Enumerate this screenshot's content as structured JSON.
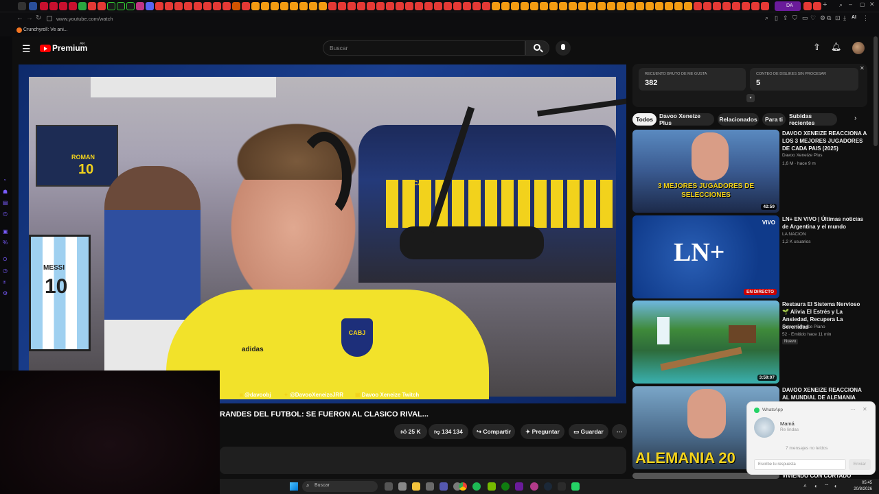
{
  "browser": {
    "url": "www.youtube.com/watch",
    "bookmark_label": "Crunchyroll: Ve ani...",
    "profile_badge": "DA",
    "ai_label": "AI"
  },
  "youtube": {
    "logo_text": "Premium",
    "region": "AR",
    "search_placeholder": "Buscar",
    "likes_panel": {
      "likes_label": "RECUENTO BRUTO DE ME GUSTA",
      "likes_value": "382",
      "dislikes_label": "CONTEO DE DISLIKES SIN PROCESAR",
      "dislikes_value": "5"
    },
    "chips": [
      "Todos",
      "Davoo Xeneize Plus",
      "Relacionados",
      "Para ti",
      "Subidas recientes"
    ],
    "video": {
      "socials": [
        "@davoobj",
        "@DavooXeneizeJRR",
        "Davoo Xeneize Twitch"
      ],
      "title": "RANDES DEL FUTBOL: SE FUERON AL CLASICO RIVAL...",
      "like_count": "25 K",
      "dislike_count": "134  134",
      "share_label": "Compartir",
      "ask_label": "Preguntar",
      "save_label": "Guardar",
      "overlay_text": [
        "ROMAN",
        "10",
        "MESSI",
        "10",
        "CABJ",
        "adidas"
      ]
    },
    "recommendations": [
      {
        "title": "DAVOO XENEIZE REACCIONA A LOS 3 MEJORES JUGADORES DE CADA PAIS (2025)",
        "channel": "Davoo Xeneize Plus",
        "meta": "1,6 M · hace 9 m",
        "duration": "42:59",
        "thumb_text": "3 MEJORES JUGADORES DE SELECCIONES"
      },
      {
        "title": "LN+ EN VIVO | Últimas noticias de Argentina y el mundo",
        "channel": "LA NACION",
        "meta": "1,2 K usuarios",
        "duration": "EN DIRECTO",
        "thumb_text": "LN+",
        "live_label": "VIVO"
      },
      {
        "title": "Restaura El Sistema Nervioso 🌱 Alivia El Estrés y La Ansiedad, Recupera La Serenidad",
        "channel": "Nature's Peace Piano",
        "meta": "52 · Emitido hace 11 min",
        "badge": "Nuevo",
        "duration": "3:59:07"
      },
      {
        "title": "DAVOO XENEIZE REACCIONA AL MUNDIAL DE ALEMANIA 2006 - EL",
        "channel": "",
        "meta": "",
        "thumb_text": "ALEMANIA 20"
      },
      {
        "title": "VIVIENDO CON CORTADO DOBLE",
        "channel": "",
        "meta": ""
      }
    ]
  },
  "whatsapp": {
    "app": "WhatsApp",
    "sender": "Mamá",
    "preview": "Re lindas",
    "unread": "7 mensajes no leídos",
    "reply_placeholder": "Escribe tu respuesta",
    "send_label": "Enviar"
  },
  "taskbar": {
    "search_label": "Buscar",
    "time": "05:45",
    "date": "20/8/2026"
  }
}
